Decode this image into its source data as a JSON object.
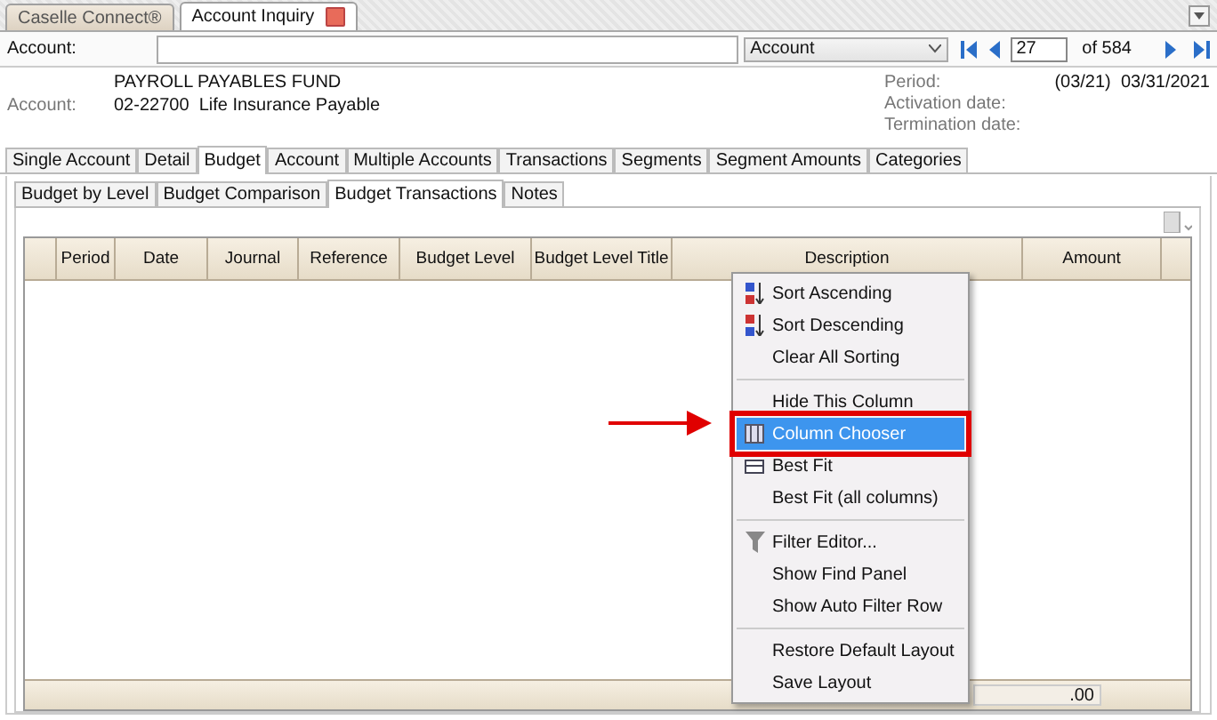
{
  "doc_tabs": [
    {
      "label": "Caselle Connect®",
      "selected": false,
      "closable": false
    },
    {
      "label": "Account Inquiry",
      "selected": true,
      "closable": true
    }
  ],
  "account_bar": {
    "label": "Account:",
    "lookup": "Account",
    "record": "27",
    "of": "of 584"
  },
  "info": {
    "fund": "PAYROLL PAYABLES FUND",
    "label": "Account:",
    "account": "02-22700  Life Insurance Payable",
    "period_label": "Period:",
    "period_value": "(03/21)  03/31/2021",
    "activation_label": "Activation date:",
    "termination_label": "Termination date:"
  },
  "tabs": [
    {
      "label": "Single Account",
      "selected": false
    },
    {
      "label": "Detail",
      "selected": false
    },
    {
      "label": "Budget",
      "selected": true
    },
    {
      "label": "Account",
      "selected": false
    },
    {
      "label": "Multiple Accounts",
      "selected": false
    },
    {
      "label": "Transactions",
      "selected": false
    },
    {
      "label": "Segments",
      "selected": false
    },
    {
      "label": "Segment Amounts",
      "selected": false
    },
    {
      "label": "Categories",
      "selected": false
    }
  ],
  "sub_tabs": [
    {
      "label": "Budget by Level",
      "selected": false
    },
    {
      "label": "Budget Comparison",
      "selected": false
    },
    {
      "label": "Budget Transactions",
      "selected": true
    },
    {
      "label": "Notes",
      "selected": false
    }
  ],
  "table": {
    "columns": [
      "Period",
      "Date",
      "Journal",
      "Reference",
      "Budget Level",
      "Budget Level Title",
      "Description",
      "Amount"
    ],
    "footer_total": ".00"
  },
  "context_menu": {
    "groups": [
      [
        {
          "label": "Sort Ascending",
          "selected": false
        },
        {
          "label": "Sort Descending",
          "selected": false
        },
        {
          "label": "Clear All Sorting",
          "selected": false
        }
      ],
      [
        {
          "label": "Hide This Column",
          "selected": false
        },
        {
          "label": "Column Chooser",
          "selected": true
        },
        {
          "label": "Best Fit",
          "selected": false
        },
        {
          "label": "Best Fit (all columns)",
          "selected": false
        }
      ],
      [
        {
          "label": "Filter Editor...",
          "selected": false
        },
        {
          "label": "Show Find Panel",
          "selected": false
        },
        {
          "label": "Show Auto Filter Row",
          "selected": false
        }
      ],
      [
        {
          "label": "Restore Default Layout",
          "selected": false
        },
        {
          "label": "Save Layout",
          "selected": false
        }
      ]
    ]
  }
}
